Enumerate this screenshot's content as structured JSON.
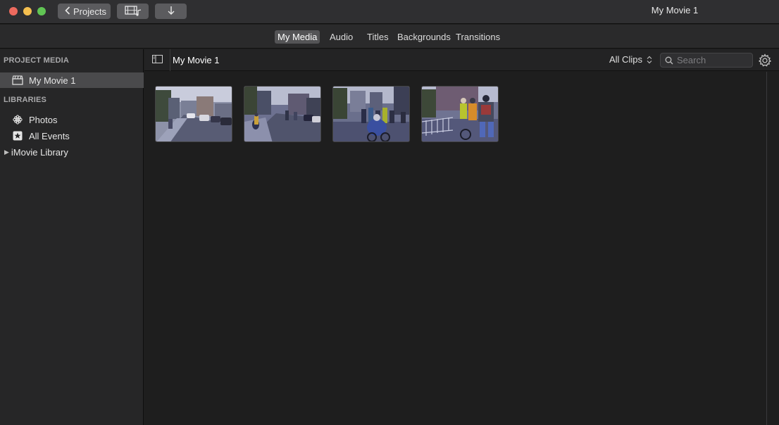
{
  "window": {
    "title": "My Movie 1",
    "back_button": "Projects",
    "media_button_icon": "film-music-icon",
    "import_button_icon": "down-arrow-icon"
  },
  "tabs": [
    {
      "label": "My Media",
      "active": true
    },
    {
      "label": "Audio",
      "active": false
    },
    {
      "label": "Titles",
      "active": false
    },
    {
      "label": "Backgrounds",
      "active": false
    },
    {
      "label": "Transitions",
      "active": false
    }
  ],
  "sidebar": {
    "project_media_header": "PROJECT MEDIA",
    "project_item": "My Movie 1",
    "libraries_header": "LIBRARIES",
    "libraries": [
      {
        "label": "Photos",
        "icon": "photos-flower-icon"
      },
      {
        "label": "All Events",
        "icon": "star-icon"
      },
      {
        "label": "iMovie Library",
        "icon": "disclosure-triangle-icon"
      }
    ]
  },
  "browser": {
    "title": "My Movie 1",
    "filter": "All Clips",
    "search_placeholder": "Search",
    "clips": [
      {
        "name": "clip-1",
        "scene": "street with parked cars"
      },
      {
        "name": "clip-2",
        "scene": "cyclists on street"
      },
      {
        "name": "clip-3",
        "scene": "group of cyclists"
      },
      {
        "name": "clip-4",
        "scene": "cyclists at barricade"
      }
    ]
  },
  "colors": {
    "accent_selected": "#4a4a4c",
    "close": "#ed6a5e",
    "minimize": "#f5bf4f",
    "maximize": "#61c554"
  }
}
